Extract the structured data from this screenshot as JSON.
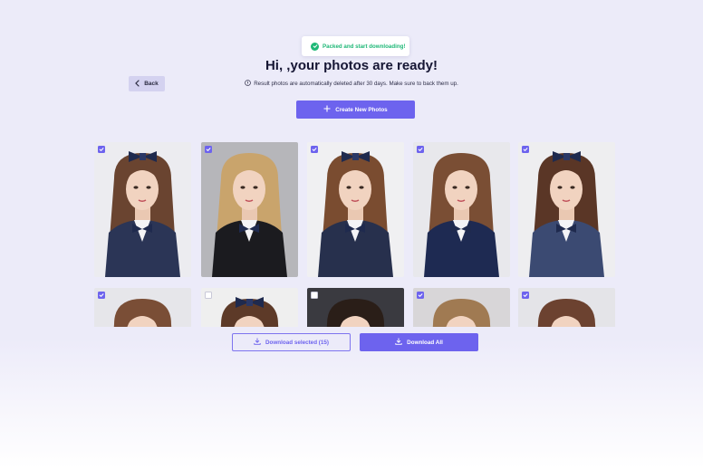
{
  "toast": {
    "message": "Packed and start downloading!",
    "icon": "check-circle-icon",
    "color": "#1fb877"
  },
  "header": {
    "title": "Hi, ,your photos are ready!",
    "notice": "Result photos are automatically deleted after 30 days. Make sure to back them up.",
    "notice_icon": "info-icon"
  },
  "nav": {
    "back_label": "Back",
    "back_icon": "chevron-left-icon"
  },
  "actions": {
    "create_label": "Create New Photos",
    "create_icon": "plus-icon",
    "download_selected_label": "Download  selected (15)",
    "download_all_label": "Download All",
    "download_icon": "download-icon"
  },
  "colors": {
    "accent": "#6d63ee",
    "background": "#ecebf9",
    "success": "#1fb877"
  },
  "photos": [
    {
      "checked": true,
      "bg": "#ececf0",
      "hair": "#6a4430",
      "outfit": "#2b3556",
      "bow": true
    },
    {
      "checked": true,
      "bg": "#b6b6ba",
      "hair": "#c9a46c",
      "outfit": "#1b1b1f",
      "bow": false
    },
    {
      "checked": true,
      "bg": "#f0f0f2",
      "hair": "#7a4c30",
      "outfit": "#27304d",
      "bow": true
    },
    {
      "checked": true,
      "bg": "#e8e8ec",
      "hair": "#7a4e34",
      "outfit": "#1e2a52",
      "bow": false
    },
    {
      "checked": true,
      "bg": "#eeeef0",
      "hair": "#5a3626",
      "outfit": "#3b4a72",
      "bow": true
    },
    {
      "checked": true,
      "bg": "#e6e6ea",
      "hair": "#7a4e36",
      "outfit": "#2b3556",
      "bow": false
    },
    {
      "checked": false,
      "bg": "#efefef",
      "hair": "#5d3a28",
      "outfit": "#2b3556",
      "bow": true
    },
    {
      "checked": false,
      "bg": "#3a3a40",
      "hair": "#2a1e18",
      "outfit": "#2b3556",
      "bow": false
    },
    {
      "checked": true,
      "bg": "#d8d6d8",
      "hair": "#a07a52",
      "outfit": "#2b3556",
      "bow": false
    },
    {
      "checked": true,
      "bg": "#e4e4e8",
      "hair": "#6c4230",
      "outfit": "#2b3556",
      "bow": false
    }
  ]
}
